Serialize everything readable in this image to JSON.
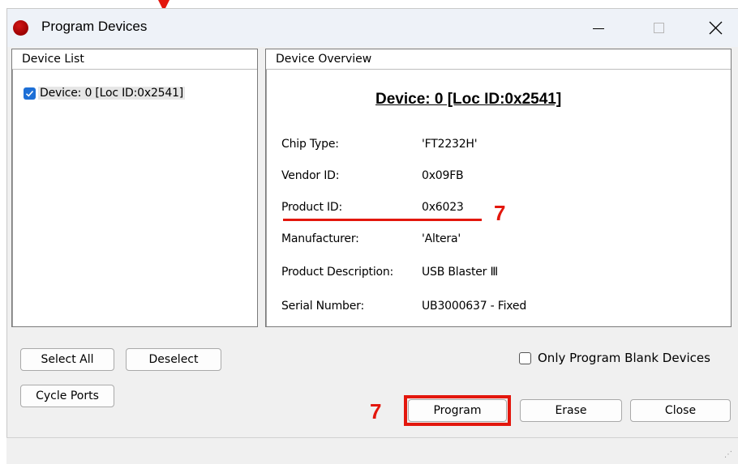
{
  "window": {
    "title": "Program Devices"
  },
  "device_list": {
    "header": "Device List",
    "items": [
      {
        "label": "Device: 0 [Loc ID:0x2541]",
        "checked": true
      }
    ]
  },
  "overview": {
    "header": "Device Overview",
    "heading": "Device: 0 [Loc ID:0x2541]",
    "properties": [
      {
        "label": "Chip Type:",
        "value": "'FT2232H'"
      },
      {
        "label": "Vendor ID:",
        "value": "0x09FB"
      },
      {
        "label": "Product ID:",
        "value": "0x6023"
      },
      {
        "label": "Manufacturer:",
        "value": "'Altera'"
      },
      {
        "label": "Product Description:",
        "value": "USB Blaster Ⅲ"
      },
      {
        "label": "Serial Number:",
        "value": "UB3000637 - Fixed"
      }
    ]
  },
  "buttons": {
    "select_all": "Select All",
    "deselect": "Deselect",
    "cycle_ports": "Cycle Ports",
    "program": "Program",
    "erase": "Erase",
    "close": "Close"
  },
  "options": {
    "only_blank": "Only Program Blank Devices",
    "only_blank_checked": false
  },
  "annotations": {
    "marker_1": "7",
    "marker_2": "7",
    "color": "#e3170d"
  },
  "colors": {
    "titlebar_bg": "#eef2f8",
    "checkbox_accent": "#1d6fd6",
    "window_bg": "#f0f0f0"
  }
}
